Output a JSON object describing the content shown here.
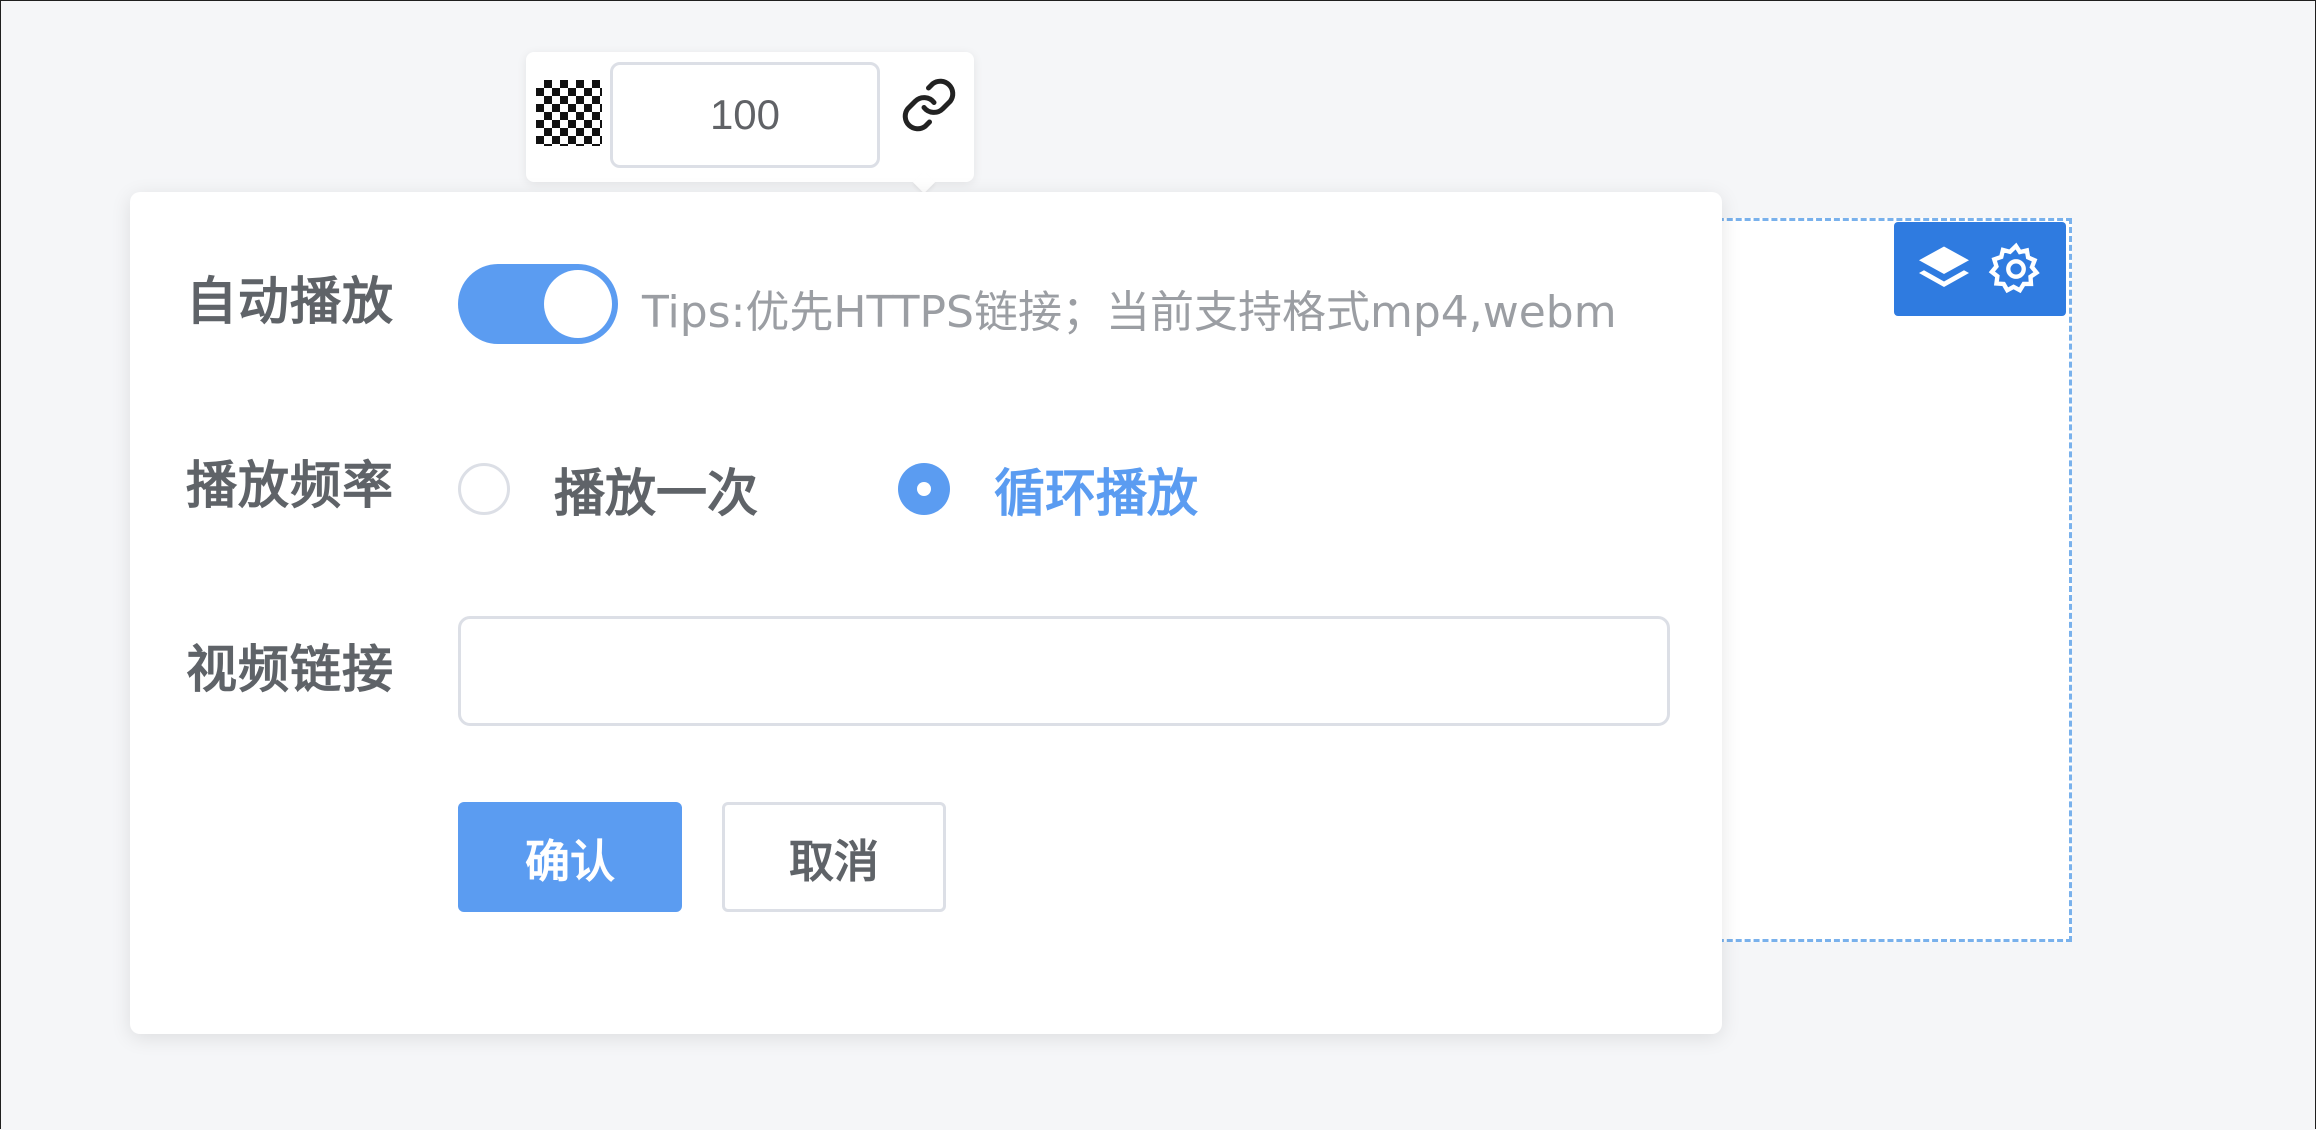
{
  "toolbar": {
    "opacity_value": "100",
    "checker_icon": "transparency-checker-icon",
    "link_icon": "link-icon"
  },
  "form": {
    "autoplay_label": "自动播放",
    "autoplay_on": true,
    "tips": "Tips:优先HTTPS链接；当前支持格式mp4,webm",
    "frequency_label": "播放频率",
    "frequency_options": [
      "播放一次",
      "循环播放"
    ],
    "frequency_selected": "循环播放",
    "video_link_label": "视频链接",
    "video_link_value": "",
    "confirm_label": "确认",
    "cancel_label": "取消"
  },
  "block": {
    "layers_icon": "layers-icon",
    "settings_icon": "gear-icon"
  },
  "colors": {
    "accent": "#5b9cf1",
    "block_toolbar": "#2f7be0",
    "dashed_border": "#79b1ec"
  }
}
